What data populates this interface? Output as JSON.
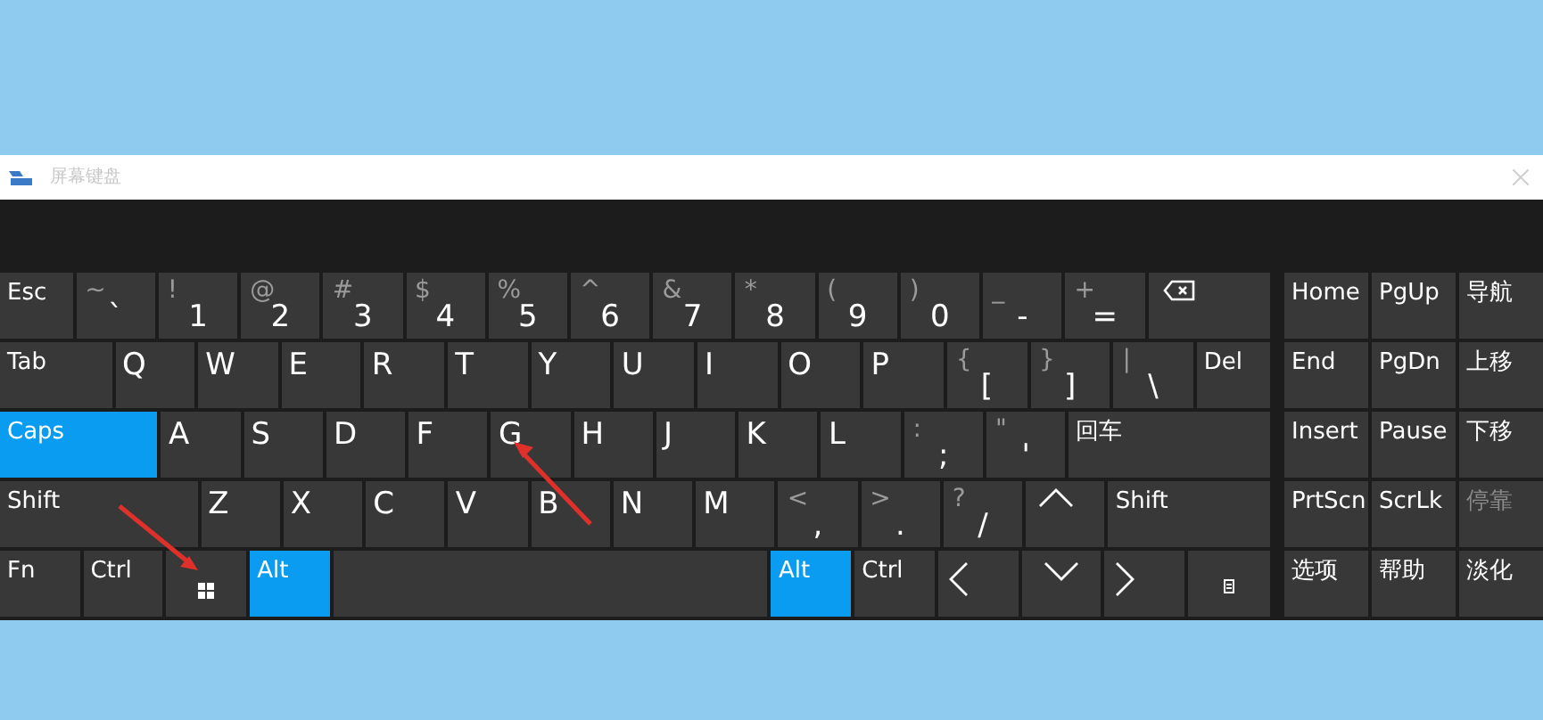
{
  "window": {
    "title": "屏幕键盘"
  },
  "keyboard": {
    "rows": [
      [
        {
          "kind": "text",
          "label": "Esc",
          "on": false
        },
        {
          "kind": "dual",
          "top": "~",
          "main": "`",
          "on": false
        },
        {
          "kind": "dual",
          "top": "!",
          "main": "1",
          "on": false
        },
        {
          "kind": "dual",
          "top": "@",
          "main": "2",
          "on": false
        },
        {
          "kind": "dual",
          "top": "#",
          "main": "3",
          "on": false
        },
        {
          "kind": "dual",
          "top": "$",
          "main": "4",
          "on": false
        },
        {
          "kind": "dual",
          "top": "%",
          "main": "5",
          "on": false
        },
        {
          "kind": "dual",
          "top": "^",
          "main": "6",
          "on": false
        },
        {
          "kind": "dual",
          "top": "&",
          "main": "7",
          "on": false
        },
        {
          "kind": "dual",
          "top": "*",
          "main": "8",
          "on": false
        },
        {
          "kind": "dual",
          "top": "(",
          "main": "9",
          "on": false
        },
        {
          "kind": "dual",
          "top": ")",
          "main": "0",
          "on": false
        },
        {
          "kind": "dual",
          "top": "_",
          "main": "-",
          "on": false
        },
        {
          "kind": "dual",
          "top": "+",
          "main": "=",
          "on": false
        },
        {
          "kind": "backspace",
          "on": false
        }
      ],
      [
        {
          "kind": "text",
          "label": "Tab",
          "on": false
        },
        {
          "kind": "letter",
          "label": "Q",
          "on": false
        },
        {
          "kind": "letter",
          "label": "W",
          "on": false
        },
        {
          "kind": "letter",
          "label": "E",
          "on": false
        },
        {
          "kind": "letter",
          "label": "R",
          "on": false
        },
        {
          "kind": "letter",
          "label": "T",
          "on": false
        },
        {
          "kind": "letter",
          "label": "Y",
          "on": false
        },
        {
          "kind": "letter",
          "label": "U",
          "on": false
        },
        {
          "kind": "letter",
          "label": "I",
          "on": false
        },
        {
          "kind": "letter",
          "label": "O",
          "on": false
        },
        {
          "kind": "letter",
          "label": "P",
          "on": false
        },
        {
          "kind": "dual",
          "top": "{",
          "main": "[",
          "on": false
        },
        {
          "kind": "dual",
          "top": "}",
          "main": "]",
          "on": false
        },
        {
          "kind": "dual",
          "top": "|",
          "main": "\\",
          "on": false
        },
        {
          "kind": "text",
          "label": "Del",
          "on": false
        }
      ],
      [
        {
          "kind": "text",
          "label": "Caps",
          "on": true
        },
        {
          "kind": "letter",
          "label": "A",
          "on": false
        },
        {
          "kind": "letter",
          "label": "S",
          "on": false
        },
        {
          "kind": "letter",
          "label": "D",
          "on": false
        },
        {
          "kind": "letter",
          "label": "F",
          "on": false
        },
        {
          "kind": "letter",
          "label": "G",
          "on": false
        },
        {
          "kind": "letter",
          "label": "H",
          "on": false
        },
        {
          "kind": "letter",
          "label": "J",
          "on": false
        },
        {
          "kind": "letter",
          "label": "K",
          "on": false
        },
        {
          "kind": "letter",
          "label": "L",
          "on": false
        },
        {
          "kind": "dual",
          "top": ":",
          "main": ";",
          "on": false
        },
        {
          "kind": "dual",
          "top": "\"",
          "main": "'",
          "on": false
        },
        {
          "kind": "text",
          "label": "回车",
          "on": false
        }
      ],
      [
        {
          "kind": "text",
          "label": "Shift",
          "on": false
        },
        {
          "kind": "letter",
          "label": "Z",
          "on": false
        },
        {
          "kind": "letter",
          "label": "X",
          "on": false
        },
        {
          "kind": "letter",
          "label": "C",
          "on": false
        },
        {
          "kind": "letter",
          "label": "V",
          "on": false
        },
        {
          "kind": "letter",
          "label": "B",
          "on": false
        },
        {
          "kind": "letter",
          "label": "N",
          "on": false
        },
        {
          "kind": "letter",
          "label": "M",
          "on": false
        },
        {
          "kind": "dual",
          "top": "<",
          "main": ",",
          "on": false
        },
        {
          "kind": "dual",
          "top": ">",
          "main": ".",
          "on": false
        },
        {
          "kind": "dual",
          "top": "?",
          "main": "/",
          "on": false
        },
        {
          "kind": "up",
          "on": false
        },
        {
          "kind": "text",
          "label": "Shift",
          "on": false
        }
      ],
      [
        {
          "kind": "text",
          "label": "Fn",
          "on": false
        },
        {
          "kind": "text",
          "label": "Ctrl",
          "on": false
        },
        {
          "kind": "windows",
          "on": false
        },
        {
          "kind": "text",
          "label": "Alt",
          "on": true
        },
        {
          "kind": "space",
          "on": false
        },
        {
          "kind": "text",
          "label": "Alt",
          "on": true
        },
        {
          "kind": "text",
          "label": "Ctrl",
          "on": false
        },
        {
          "kind": "left",
          "on": false
        },
        {
          "kind": "down",
          "on": false
        },
        {
          "kind": "right",
          "on": false
        },
        {
          "kind": "menu",
          "on": false
        }
      ]
    ]
  },
  "nav_keys": [
    {
      "label": "Home",
      "disabled": false
    },
    {
      "label": "PgUp",
      "disabled": false
    },
    {
      "label": "导航",
      "disabled": false
    },
    {
      "label": "End",
      "disabled": false
    },
    {
      "label": "PgDn",
      "disabled": false
    },
    {
      "label": "上移",
      "disabled": false
    },
    {
      "label": "Insert",
      "disabled": false
    },
    {
      "label": "Pause",
      "disabled": false
    },
    {
      "label": "下移",
      "disabled": false
    },
    {
      "label": "PrtScn",
      "disabled": false
    },
    {
      "label": "ScrLk",
      "disabled": false
    },
    {
      "label": "停靠",
      "disabled": true
    },
    {
      "label": "选项",
      "disabled": false
    },
    {
      "label": "帮助",
      "disabled": false
    },
    {
      "label": "淡化",
      "disabled": false
    }
  ]
}
